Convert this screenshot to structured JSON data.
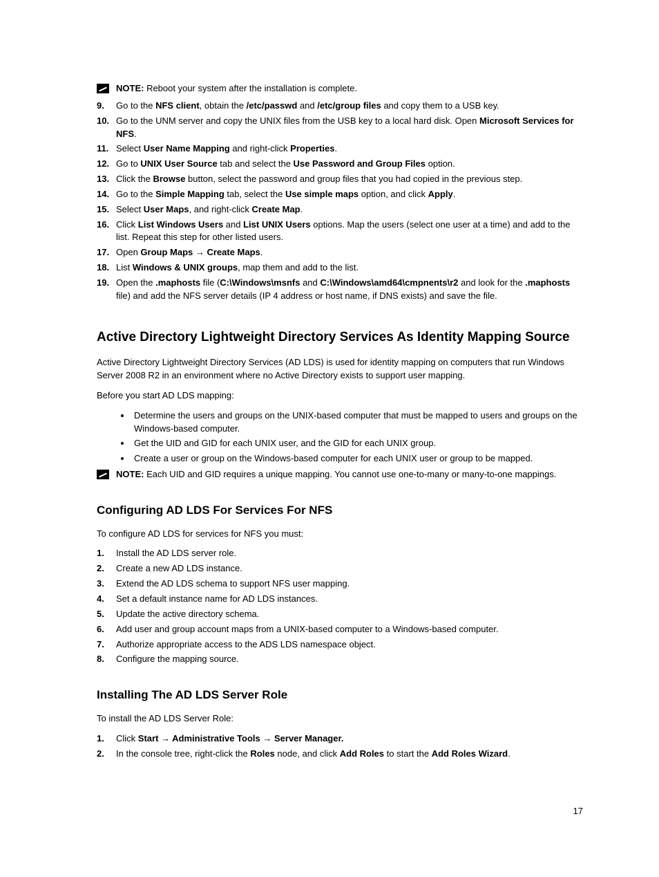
{
  "note1_prefix": "NOTE:",
  "note1_text": " Reboot your system after the installation is complete.",
  "top_list": [
    {
      "n": "9.",
      "segs": [
        {
          "t": "Go to the "
        },
        {
          "t": "NFS client",
          "b": 1
        },
        {
          "t": ", obtain the "
        },
        {
          "t": "/etc/passwd",
          "b": 1
        },
        {
          "t": " and "
        },
        {
          "t": "/etc/group files",
          "b": 1
        },
        {
          "t": " and copy them to a USB key."
        }
      ]
    },
    {
      "n": "10.",
      "segs": [
        {
          "t": "Go to the UNM server and copy the UNIX files from the USB key to a local hard disk. Open "
        },
        {
          "t": "Microsoft Services for NFS",
          "b": 1
        },
        {
          "t": "."
        }
      ]
    },
    {
      "n": "11.",
      "segs": [
        {
          "t": "Select "
        },
        {
          "t": "User Name Mapping",
          "b": 1
        },
        {
          "t": " and right-click "
        },
        {
          "t": "Properties",
          "b": 1
        },
        {
          "t": "."
        }
      ]
    },
    {
      "n": "12.",
      "segs": [
        {
          "t": "Go to "
        },
        {
          "t": "UNIX User Source",
          "b": 1
        },
        {
          "t": " tab and select the "
        },
        {
          "t": "Use Password and Group Files",
          "b": 1
        },
        {
          "t": " option."
        }
      ]
    },
    {
      "n": "13.",
      "segs": [
        {
          "t": "Click the "
        },
        {
          "t": "Browse",
          "b": 1
        },
        {
          "t": " button, select the password and group files that you had copied in the previous step."
        }
      ]
    },
    {
      "n": "14.",
      "segs": [
        {
          "t": "Go to the "
        },
        {
          "t": "Simple Mapping",
          "b": 1
        },
        {
          "t": " tab, select the "
        },
        {
          "t": "Use simple maps",
          "b": 1
        },
        {
          "t": " option, and click "
        },
        {
          "t": "Apply",
          "b": 1
        },
        {
          "t": "."
        }
      ]
    },
    {
      "n": "15.",
      "segs": [
        {
          "t": "Select "
        },
        {
          "t": "User Maps",
          "b": 1
        },
        {
          "t": ", and right-click "
        },
        {
          "t": "Create Map",
          "b": 1
        },
        {
          "t": "."
        }
      ]
    },
    {
      "n": "16.",
      "segs": [
        {
          "t": "Click "
        },
        {
          "t": "List Windows Users",
          "b": 1
        },
        {
          "t": " and "
        },
        {
          "t": "List UNIX Users",
          "b": 1
        },
        {
          "t": " options. Map the users (select one user at a time) and add to the list. Repeat this step for other listed users."
        }
      ]
    },
    {
      "n": "17.",
      "segs": [
        {
          "t": "Open "
        },
        {
          "t": "Group Maps → Create Maps",
          "b": 1
        },
        {
          "t": "."
        }
      ]
    },
    {
      "n": "18.",
      "segs": [
        {
          "t": "List "
        },
        {
          "t": "Windows & UNIX groups",
          "b": 1
        },
        {
          "t": ", map them and add to the list."
        }
      ]
    },
    {
      "n": "19.",
      "segs": [
        {
          "t": "Open the "
        },
        {
          "t": ".maphosts",
          "b": 1
        },
        {
          "t": " file ("
        },
        {
          "t": "C:\\Windows\\msnfs",
          "b": 1
        },
        {
          "t": " and "
        },
        {
          "t": "C:\\Windows\\amd64\\cmpnents\\r2",
          "b": 1
        },
        {
          "t": " and look for the "
        },
        {
          "t": ".maphosts",
          "b": 1
        },
        {
          "t": " file) and add the NFS server details (IP 4 address or host name, if DNS exists) and save the file."
        }
      ]
    }
  ],
  "h2_adlds": "Active Directory Lightweight Directory Services As Identity Mapping Source",
  "adlds_p1": "Active Directory Lightweight Directory Services (AD LDS) is used for identity mapping on computers that run Windows Server 2008 R2 in an environment where no Active Directory exists to support user mapping.",
  "adlds_p2": "Before you start AD LDS mapping:",
  "adlds_bullets": [
    "Determine the users and groups on the UNIX-based computer that must be mapped to users and groups on the Windows-based computer.",
    "Get the UID and GID for each UNIX user, and the GID for each UNIX group.",
    "Create a user or group on the Windows-based computer for each UNIX user or group to be mapped."
  ],
  "note2_prefix": "NOTE:",
  "note2_text": " Each UID and GID requires a unique mapping. You cannot use one-to-many or many-to-one mappings.",
  "h3_conf": "Configuring AD LDS For Services For NFS",
  "conf_p1": "To configure AD LDS for services for NFS you must:",
  "conf_list": [
    {
      "n": "1.",
      "t": "Install the AD LDS server role."
    },
    {
      "n": "2.",
      "t": "Create a new AD LDS instance."
    },
    {
      "n": "3.",
      "t": "Extend the AD LDS schema to support NFS user mapping."
    },
    {
      "n": "4.",
      "t": "Set a default instance name for AD LDS instances."
    },
    {
      "n": "5.",
      "t": "Update the active directory schema."
    },
    {
      "n": "6.",
      "t": "Add user and group account maps from a UNIX-based computer to a Windows-based computer."
    },
    {
      "n": "7.",
      "t": "Authorize appropriate access to the ADS LDS namespace object."
    },
    {
      "n": "8.",
      "t": "Configure the mapping source."
    }
  ],
  "h3_install": "Installing The AD LDS Server Role",
  "install_p1": "To install the AD LDS Server Role:",
  "install_list": [
    {
      "n": "1.",
      "segs": [
        {
          "t": "Click "
        },
        {
          "t": "Start → Administrative Tools → Server Manager.",
          "b": 1
        }
      ]
    },
    {
      "n": "2.",
      "segs": [
        {
          "t": "In the console tree, right-click the "
        },
        {
          "t": "Roles",
          "b": 1
        },
        {
          "t": " node, and click "
        },
        {
          "t": "Add Roles",
          "b": 1
        },
        {
          "t": " to start the "
        },
        {
          "t": "Add Roles Wizard",
          "b": 1
        },
        {
          "t": "."
        }
      ]
    }
  ],
  "page_number": "17"
}
